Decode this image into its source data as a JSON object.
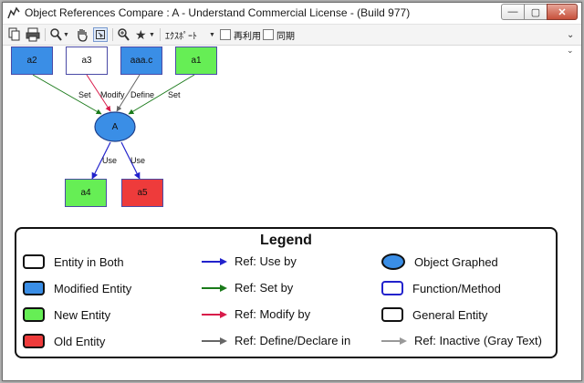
{
  "window": {
    "title": "Object References Compare : A - Understand Commercial License - (Build 977)",
    "controls": {
      "minimize": "—",
      "maximize": "▢",
      "close": "✕"
    }
  },
  "toolbar": {
    "export_label": "ｴｸｽﾎﾟｰﾄ",
    "reuse_label": "再利用",
    "sync_label": "同期",
    "icons": [
      "copy-icon",
      "print-icon",
      "zoom-icon",
      "pan-hand-icon",
      "select-icon",
      "zoom-fit-icon",
      "star-icon"
    ]
  },
  "colors": {
    "modified": "#3a8ee6",
    "new": "#66ee55",
    "old": "#ee3b3b",
    "both": "#ffffff",
    "ref_use": "#2222cc",
    "ref_set": "#1a7a1a",
    "ref_modify": "#d81b4a",
    "ref_define": "#666666",
    "ref_inactive": "#999999"
  },
  "graph": {
    "nodes": {
      "a2": "a2",
      "a3": "a3",
      "aaa_c": "aaa.c",
      "a1": "a1",
      "center": "A",
      "a4": "a4",
      "a5": "a5"
    },
    "edges": {
      "set_left": "Set",
      "modify": "Modify",
      "define": "Define",
      "set_right": "Set",
      "use_left": "Use",
      "use_right": "Use"
    }
  },
  "legend": {
    "title": "Legend",
    "entity_both": "Entity in Both",
    "modified_entity": "Modified Entity",
    "new_entity": "New Entity",
    "old_entity": "Old Entity",
    "ref_use_by": "Ref: Use by",
    "ref_set_by": "Ref: Set by",
    "ref_modify_by": "Ref: Modify by",
    "ref_define": "Ref: Define/Declare in",
    "object_graphed": "Object Graphed",
    "function_method": "Function/Method",
    "general_entity": "General Entity",
    "ref_inactive": "Ref: Inactive (Gray Text)"
  }
}
